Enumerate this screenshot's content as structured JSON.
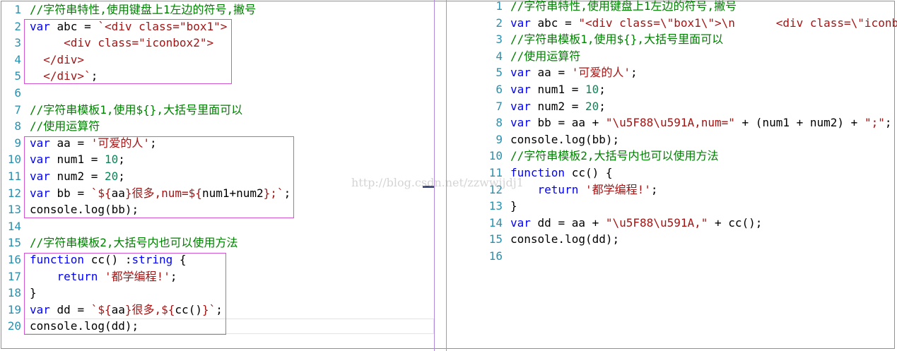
{
  "left_lines": [
    {
      "n": "1",
      "t": [
        [
          "com",
          "//字符串特性,使用键盘上1左边的符号,撇号"
        ]
      ]
    },
    {
      "n": "2",
      "t": [
        [
          "kw",
          "var"
        ],
        [
          "plain",
          " abc = "
        ],
        [
          "str",
          "`<div class=\"box1\">"
        ]
      ]
    },
    {
      "n": "3",
      "t": [
        [
          "str",
          "     <div class=\"iconbox2\">"
        ]
      ]
    },
    {
      "n": "4",
      "t": [
        [
          "str",
          "  </div>"
        ]
      ]
    },
    {
      "n": "5",
      "t": [
        [
          "str",
          "  </div>`"
        ],
        [
          "plain",
          ";"
        ]
      ]
    },
    {
      "n": "6",
      "t": []
    },
    {
      "n": "7",
      "t": [
        [
          "com",
          "//字符串模板1,使用${},大括号里面可以"
        ]
      ]
    },
    {
      "n": "8",
      "t": [
        [
          "com",
          "//使用运算符"
        ]
      ]
    },
    {
      "n": "9",
      "t": [
        [
          "kw",
          "var"
        ],
        [
          "plain",
          " aa = "
        ],
        [
          "str",
          "'可爱的人'"
        ],
        [
          "plain",
          ";"
        ]
      ]
    },
    {
      "n": "10",
      "t": [
        [
          "kw",
          "var"
        ],
        [
          "plain",
          " num1 = "
        ],
        [
          "num",
          "10"
        ],
        [
          "plain",
          ";"
        ]
      ]
    },
    {
      "n": "11",
      "t": [
        [
          "kw",
          "var"
        ],
        [
          "plain",
          " num2 = "
        ],
        [
          "num",
          "20"
        ],
        [
          "plain",
          ";"
        ]
      ]
    },
    {
      "n": "12",
      "t": [
        [
          "kw",
          "var"
        ],
        [
          "plain",
          " bb = "
        ],
        [
          "str",
          "`${"
        ],
        [
          "plain",
          "aa"
        ],
        [
          "str",
          "}很多,num=${"
        ],
        [
          "plain",
          "num1+num2"
        ],
        [
          "str",
          "};`"
        ],
        [
          "plain",
          ";"
        ]
      ]
    },
    {
      "n": "13",
      "t": [
        [
          "plain",
          "console.log(bb);"
        ]
      ]
    },
    {
      "n": "14",
      "t": []
    },
    {
      "n": "15",
      "t": [
        [
          "com",
          "//字符串模板2,大括号内也可以使用方法"
        ]
      ]
    },
    {
      "n": "16",
      "t": [
        [
          "kw",
          "function"
        ],
        [
          "plain",
          " cc() :"
        ],
        [
          "kw",
          "string"
        ],
        [
          "plain",
          " {"
        ]
      ]
    },
    {
      "n": "17",
      "t": [
        [
          "plain",
          "    "
        ],
        [
          "kw",
          "return"
        ],
        [
          "plain",
          " "
        ],
        [
          "str",
          "'都学编程!'"
        ],
        [
          "plain",
          ";"
        ]
      ]
    },
    {
      "n": "18",
      "t": [
        [
          "plain",
          "}"
        ]
      ]
    },
    {
      "n": "19",
      "t": [
        [
          "kw",
          "var"
        ],
        [
          "plain",
          " dd = "
        ],
        [
          "str",
          "`${"
        ],
        [
          "plain",
          "aa"
        ],
        [
          "str",
          "}很多,${"
        ],
        [
          "plain",
          "cc()"
        ],
        [
          "str",
          "}`"
        ],
        [
          "plain",
          ";"
        ]
      ]
    },
    {
      "n": "20",
      "t": [
        [
          "plain",
          "console.log(dd);"
        ]
      ]
    }
  ],
  "right_lines": [
    {
      "n": "1",
      "t": [
        [
          "com",
          "//字符串特性,使用键盘上1左边的符号,撇号"
        ]
      ]
    },
    {
      "n": "2",
      "t": [
        [
          "kw",
          "var"
        ],
        [
          "plain",
          " abc = "
        ],
        [
          "str",
          "\"<div class=\\\"box1\\\">\\n      <div class=\\\"iconb"
        ]
      ]
    },
    {
      "n": "3",
      "t": [
        [
          "com",
          "//字符串模板1,使用${},大括号里面可以"
        ]
      ]
    },
    {
      "n": "4",
      "t": [
        [
          "com",
          "//使用运算符"
        ]
      ]
    },
    {
      "n": "5",
      "t": [
        [
          "kw",
          "var"
        ],
        [
          "plain",
          " aa = "
        ],
        [
          "str",
          "'可爱的人'"
        ],
        [
          "plain",
          ";"
        ]
      ]
    },
    {
      "n": "6",
      "t": [
        [
          "kw",
          "var"
        ],
        [
          "plain",
          " num1 = "
        ],
        [
          "num",
          "10"
        ],
        [
          "plain",
          ";"
        ]
      ]
    },
    {
      "n": "7",
      "t": [
        [
          "kw",
          "var"
        ],
        [
          "plain",
          " num2 = "
        ],
        [
          "num",
          "20"
        ],
        [
          "plain",
          ";"
        ]
      ]
    },
    {
      "n": "8",
      "t": [
        [
          "kw",
          "var"
        ],
        [
          "plain",
          " bb = aa + "
        ],
        [
          "str",
          "\"\\u5F88\\u591A,num=\""
        ],
        [
          "plain",
          " + (num1 + num2) + "
        ],
        [
          "str",
          "\";\""
        ],
        [
          "plain",
          ";"
        ]
      ]
    },
    {
      "n": "9",
      "t": [
        [
          "plain",
          "console.log(bb);"
        ]
      ]
    },
    {
      "n": "10",
      "t": [
        [
          "com",
          "//字符串模板2,大括号内也可以使用方法"
        ]
      ]
    },
    {
      "n": "11",
      "t": [
        [
          "kw",
          "function"
        ],
        [
          "plain",
          " cc() {"
        ]
      ]
    },
    {
      "n": "12",
      "t": [
        [
          "plain",
          "    "
        ],
        [
          "kw",
          "return"
        ],
        [
          "plain",
          " "
        ],
        [
          "str",
          "'都学编程!'"
        ],
        [
          "plain",
          ";"
        ]
      ]
    },
    {
      "n": "13",
      "t": [
        [
          "plain",
          "}"
        ]
      ]
    },
    {
      "n": "14",
      "t": [
        [
          "kw",
          "var"
        ],
        [
          "plain",
          " dd = aa + "
        ],
        [
          "str",
          "\"\\u5F88\\u591A,\""
        ],
        [
          "plain",
          " + cc();"
        ]
      ]
    },
    {
      "n": "15",
      "t": [
        [
          "plain",
          "console.log(dd);"
        ]
      ]
    },
    {
      "n": "16",
      "t": []
    }
  ],
  "watermark": "http://blog.csdn.net/zzwwjjdj1",
  "colors": {
    "keyword": "#0000ff",
    "string": "#a31515",
    "comment": "#008000",
    "line_number": "#2b91af",
    "highlight_box": "#d455d4"
  }
}
